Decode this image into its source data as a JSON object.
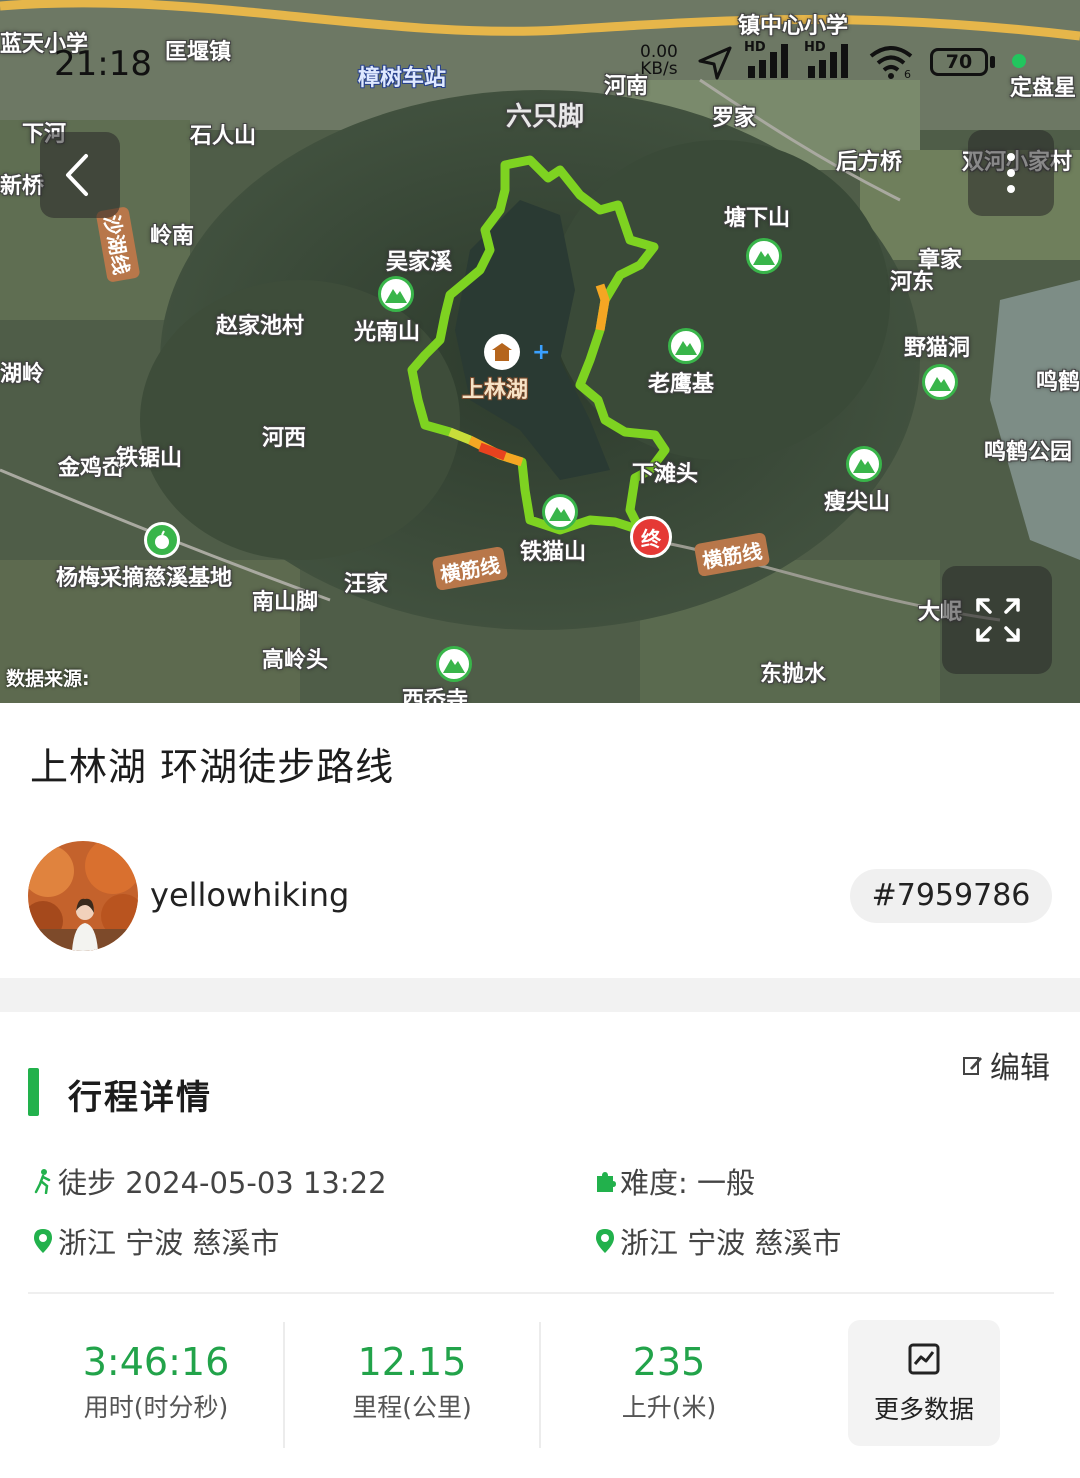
{
  "status_bar": {
    "time": "21:18",
    "net_speed": "0.00",
    "net_unit": "KB/s",
    "hd1": "HD",
    "hd2": "HD",
    "wifi_sub": "6",
    "battery": "70"
  },
  "map": {
    "labels": {
      "lantian": "蓝天小学",
      "yanzhen": "匡堰镇",
      "zhangshu_station": "樟树车站",
      "zhen_school": "镇中心小学",
      "xiahe": "下河",
      "shirenshan": "石人山",
      "liuzhijiao": "六只脚",
      "henan": "河南",
      "luojia": "罗家",
      "houfangqiao": "后方桥",
      "shuangke": "双河小家村",
      "dingpan": "定盘星",
      "xinqiao": "新桥",
      "lingnan": "岭南",
      "shaxian": "沙湖线",
      "tangxiashan": "塘下山",
      "wujiaxi": "吴家溪",
      "zhangjia": "章家",
      "hedong": "河东",
      "zhaojiachi": "赵家池村",
      "guangnanshan": "光南山",
      "shanglinhu": "上林湖",
      "laoyingji": "老鹰基",
      "yemaodong": "野猫洞",
      "minghe_right": "鸣鹤",
      "huling": "湖岭",
      "hexi": "河西",
      "jinjixi": "金鸡岙",
      "tiejushan": "铁锯山",
      "xiatantou": "下滩头",
      "minghe_park": "鸣鹤公园",
      "shoujianshan": "瘦尖山",
      "yangmei": "杨梅采摘慈溪基地",
      "tiemaoshan": "铁猫山",
      "hengjin1": "横筋线",
      "hengjin2": "横筋线",
      "wangjia": "汪家",
      "nanshanjiao": "南山脚",
      "dajiao": "大岷",
      "gaolingtou": "高岭头",
      "dongpaoshui": "东抛水",
      "xiyunsi": "西岙寺"
    },
    "end_marker": "终",
    "source_label": "数据来源:"
  },
  "route": {
    "title": "上林湖 环湖徒步路线",
    "username": "yellowhiking",
    "id_badge": "#7959786"
  },
  "details": {
    "section_title": "行程详情",
    "edit_label": "编辑",
    "activity": "徒步 2024-05-03 13:22",
    "difficulty": "难度: 一般",
    "start_location": "浙江 宁波 慈溪市",
    "end_location": "浙江 宁波 慈溪市"
  },
  "stats": [
    {
      "value": "3:46:16",
      "label": "用时(时分秒)"
    },
    {
      "value": "12.15",
      "label": "里程(公里)"
    },
    {
      "value": "235",
      "label": "上升(米)"
    }
  ],
  "more_data_label": "更多数据",
  "colors": {
    "accent_green": "#22b14c",
    "stat_green": "#22a34a",
    "track_green": "#7ed321",
    "end_red": "#e53935"
  }
}
